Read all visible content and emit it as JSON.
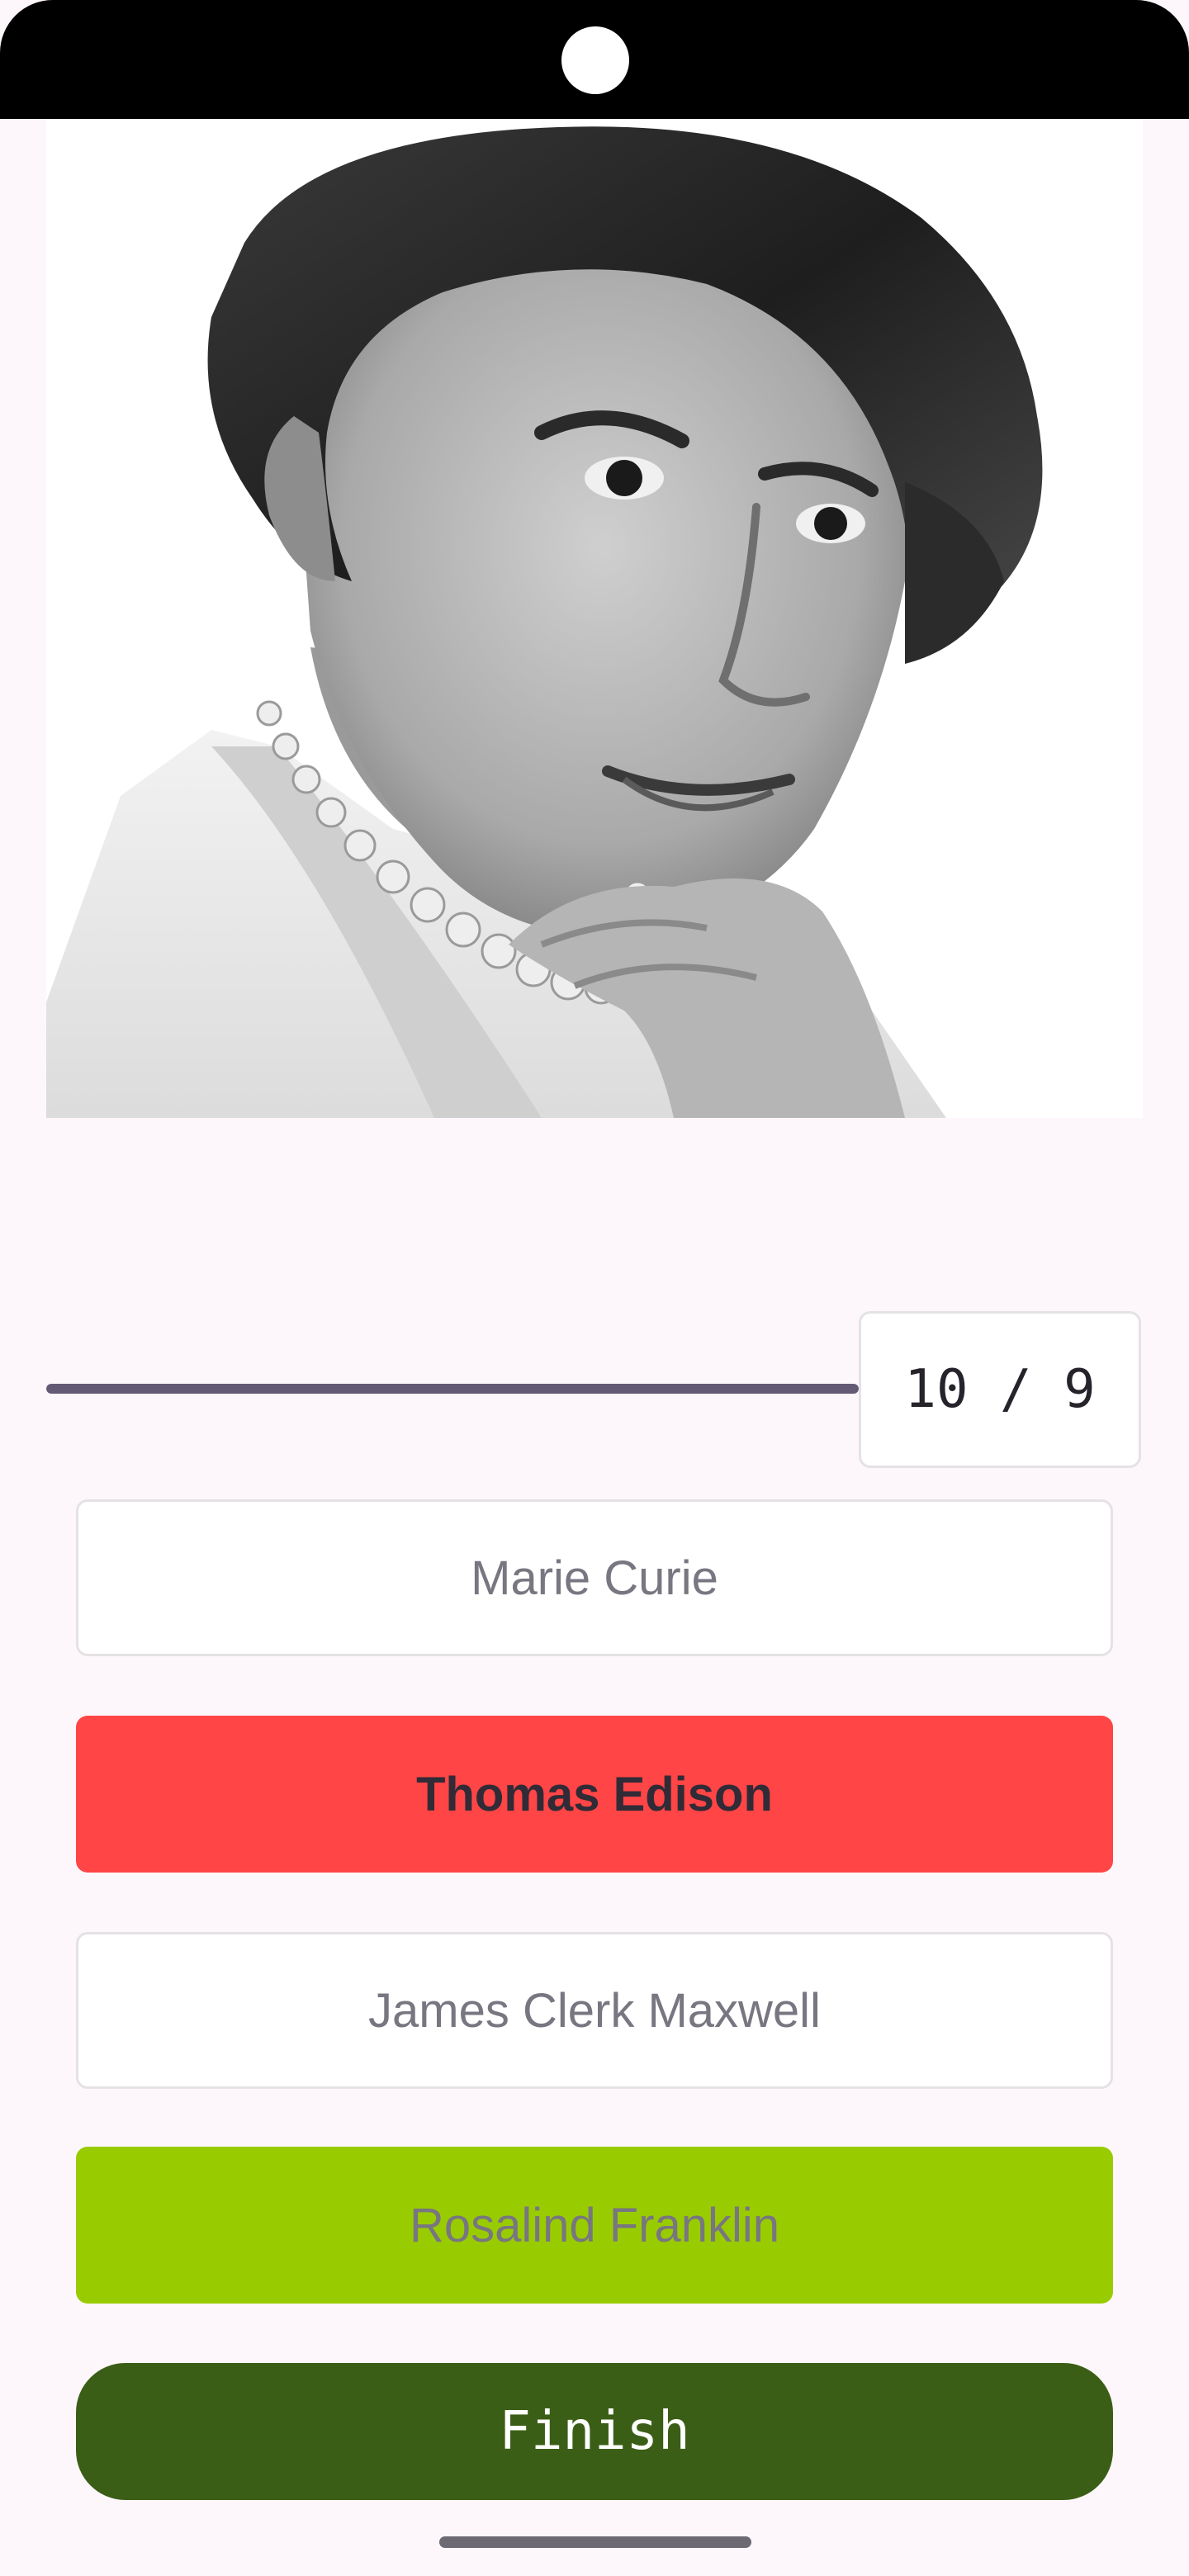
{
  "quiz": {
    "progress_fraction": 1.0,
    "counter_text": "10 / 9",
    "answers": [
      {
        "label": "Marie Curie",
        "state": "neutral"
      },
      {
        "label": "Thomas Edison",
        "state": "wrong"
      },
      {
        "label": "James Clerk Maxwell",
        "state": "neutral"
      },
      {
        "label": "Rosalind Franklin",
        "state": "correct"
      }
    ],
    "finish_label": "Finish"
  },
  "colors": {
    "background": "#fdf7fc",
    "wrong": "#ff4545",
    "correct": "#99cc00",
    "finish": "#3b5e16",
    "progress": "#645a75"
  },
  "icons": {
    "portrait": "black-and-white-portrait-photo"
  }
}
